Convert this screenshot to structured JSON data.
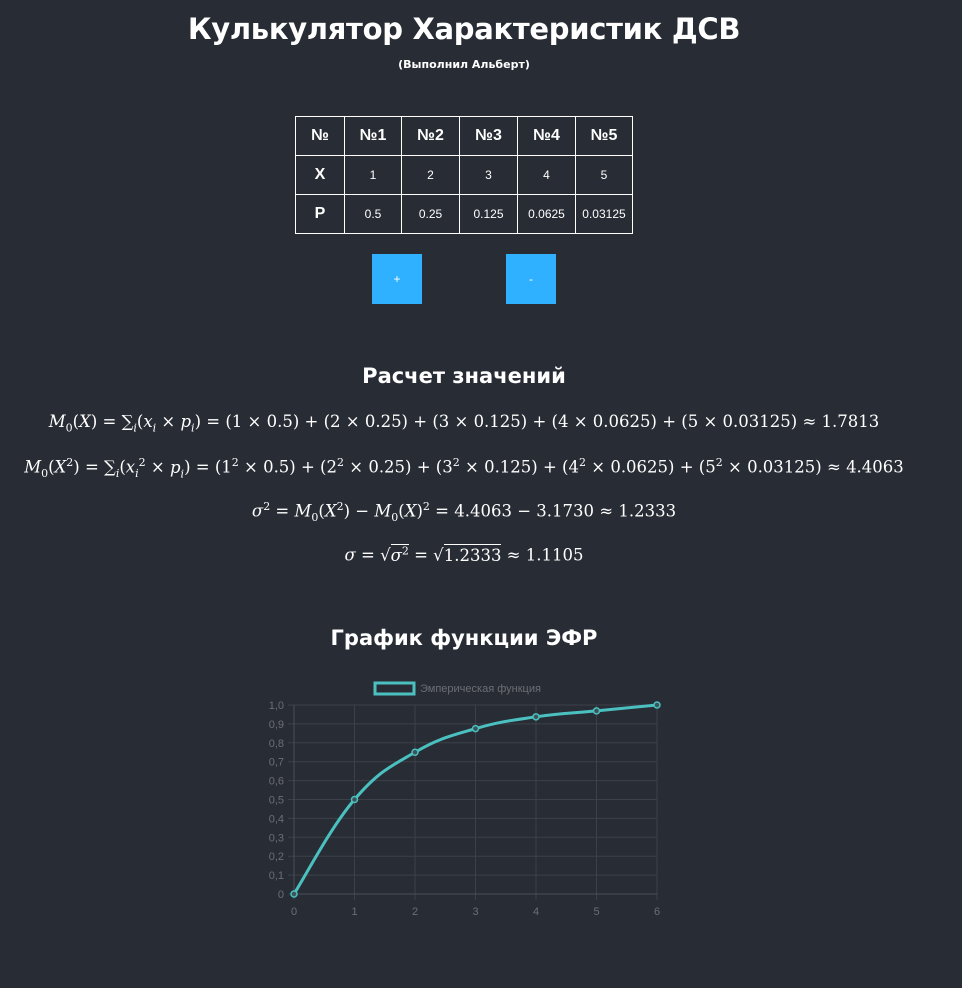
{
  "header": {
    "title": "Кулькулятор Характеристик ДСВ",
    "subtitle": "(Выполнил Альберт)"
  },
  "table": {
    "corner": "№",
    "columns": [
      "№1",
      "№2",
      "№3",
      "№4",
      "№5"
    ],
    "x_label": "X",
    "x_values": [
      "1",
      "2",
      "3",
      "4",
      "5"
    ],
    "p_label": "P",
    "p_values": [
      "0.5",
      "0.25",
      "0.125",
      "0.0625",
      "0.03125"
    ]
  },
  "buttons": {
    "add": "+",
    "remove": "-"
  },
  "calc": {
    "heading": "Расчет значений",
    "m0x_tail": " = ∑ₑ(xᵢ × pᵢ) = (1 × 0.5) + (2 × 0.25) + (3 × 0.125) + (4 × 0.0625) + (5 × 0.03125) ≈ 1.7813",
    "m0x_result": "1.7813",
    "m0x2_result": "4.4063",
    "variance_line": "4.4063 − 3.1730 ≈ 1.2333",
    "sigma_value": "1.2333",
    "sigma_result": "1.1105"
  },
  "graph": {
    "heading": "График функции ЭФР"
  },
  "chart_data": {
    "type": "line",
    "x": [
      0,
      1,
      2,
      3,
      4,
      5,
      6
    ],
    "series": [
      {
        "name": "Эмперическая функция",
        "values": [
          0,
          0.5,
          0.75,
          0.875,
          0.9375,
          0.96875,
          1.0
        ]
      }
    ],
    "xlim": [
      0,
      6
    ],
    "ylim": [
      0,
      1.0
    ],
    "y_ticks": [
      "0",
      "0,1",
      "0,2",
      "0,3",
      "0,4",
      "0,5",
      "0,6",
      "0,7",
      "0,8",
      "0,9",
      "1,0"
    ],
    "x_ticks": [
      "0",
      "1",
      "2",
      "3",
      "4",
      "5",
      "6"
    ],
    "grid": true,
    "legend": "top",
    "line_color": "#4bc0c0"
  }
}
